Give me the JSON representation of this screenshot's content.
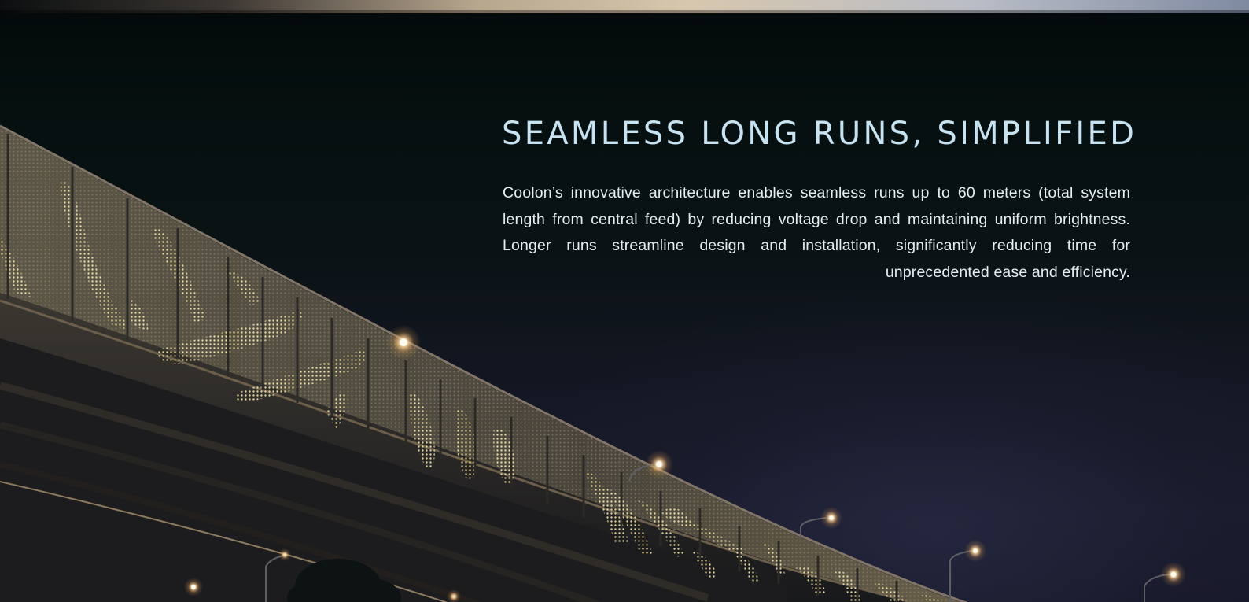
{
  "hero": {
    "headline": "SEAMLESS LONG RUNS, SIMPLIFIED",
    "body": "Coolon’s innovative architecture enables seamless runs up to 60 meters (total system length from central feed) by reducing voltage drop and maintaining uniform brightness. Longer runs streamline design and installation, significantly reducing time for unprecedented ease and efficiency."
  },
  "colors": {
    "headline": "#c7e3f2",
    "body_text": "#e7eef2",
    "night_sky": "#0a1214",
    "panel_glow": "#e8d9a0"
  },
  "background": {
    "subject": "illuminated-bridge-icon"
  }
}
